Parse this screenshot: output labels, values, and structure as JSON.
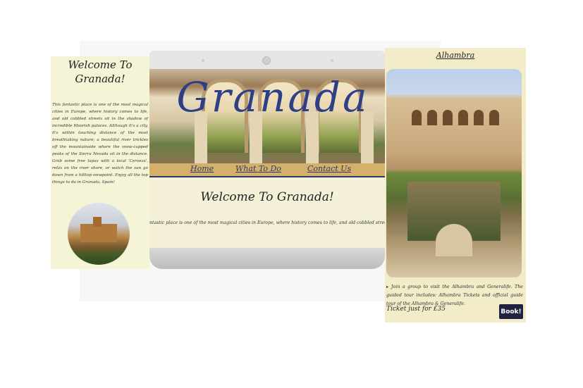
{
  "left_panel": {
    "title": "Welcome To Granada!",
    "paragraph": "This fantastic place is one of the most magical cities in Europe, where history comes to life, and old cobbled streets sit in the shadow of incredible Moorish palaces. Although it's a city, it's within touching distance of the most breathtaking nature; a beautiful river trickles off the mountainside where the snow-capped peaks of the Sierra Nevada sit in the distance. Grab some free tapas with a local 'Cerveza', relax on the river shore, or watch the sun go down from a hilltop viewpoint. Enjoy all the top things to do in Granada, Spain!",
    "image_icon": "alhambra-photo-icon"
  },
  "laptop": {
    "hero_title": "Granada",
    "nav": {
      "home": "Home",
      "what_to_do": "What To Do",
      "contact_us": "Contact Us"
    },
    "heading": "Welcome To Granada!",
    "text": "ntastic place is one of the most magical cities in Europe, where history comes to life, and old cobbled streets sit"
  },
  "right_panel": {
    "title": "Alhambra",
    "bullet": "▸",
    "description": "Join a group to visit the Alhambra and Generalife. The guided tour includes: Alhambra Tickets and official guide tour of the Alhambra & Generalife.",
    "ticket": "Ticket just for £35",
    "book_button": "Book!"
  },
  "colors": {
    "panel_bg": "#f6f4d6",
    "nav_bar": "#d4b06a",
    "title_blue": "#2f3f86",
    "button_bg": "#1f2240"
  }
}
